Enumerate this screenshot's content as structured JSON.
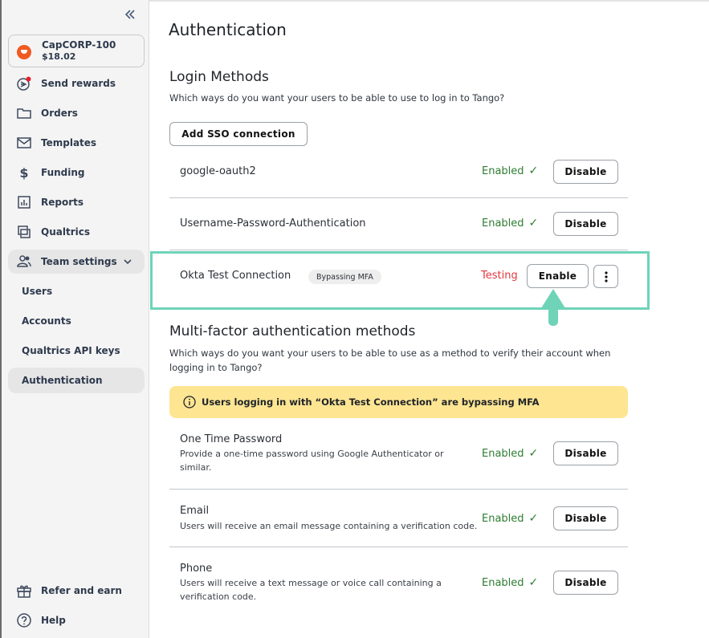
{
  "sidebar": {
    "collapse_icon": "double-chevron-left-icon",
    "account": {
      "name": "CapCORP-100",
      "balance": "$18.02",
      "logo_color": "#f05a22"
    },
    "items": [
      {
        "label": "Send rewards",
        "icon": "send-rewards-icon",
        "notification_dot": true
      },
      {
        "label": "Orders",
        "icon": "folder-icon"
      },
      {
        "label": "Templates",
        "icon": "mail-icon"
      },
      {
        "label": "Funding",
        "icon": "dollar-icon"
      },
      {
        "label": "Reports",
        "icon": "chart-icon"
      },
      {
        "label": "Qualtrics",
        "icon": "qualtrics-icon"
      },
      {
        "label": "Team settings",
        "icon": "team-icon",
        "expanded": true
      }
    ],
    "team_sub_items": [
      {
        "label": "Users"
      },
      {
        "label": "Accounts"
      },
      {
        "label": "Qualtrics API keys"
      },
      {
        "label": "Authentication",
        "active": true
      }
    ],
    "footer_items": [
      {
        "label": "Refer and earn",
        "icon": "gift-icon"
      },
      {
        "label": "Help",
        "icon": "help-icon"
      }
    ]
  },
  "main": {
    "title": "Authentication",
    "login_methods": {
      "title": "Login Methods",
      "description": "Which ways do you want your users to be able to use to log in to Tango?",
      "add_button": "Add SSO connection",
      "rows": [
        {
          "label": "google-oauth2",
          "status": "Enabled",
          "action": "Disable"
        },
        {
          "label": "Username-Password-Authentication",
          "status": "Enabled",
          "action": "Disable"
        },
        {
          "label": "Okta Test Connection",
          "badge": "Bypassing MFA",
          "status": "Testing",
          "action": "Enable",
          "has_menu": true,
          "highlighted": true
        }
      ]
    },
    "mfa_methods": {
      "title": "Multi-factor authentication methods",
      "description": "Which ways do you want your users to be able to use as a method to verify their account when logging in to Tango?",
      "alert": "Users logging in with “Okta Test Connection” are bypassing MFA",
      "rows": [
        {
          "label": "One Time Password",
          "sub": "Provide a one-time password using Google Authenticator or similar.",
          "status": "Enabled",
          "action": "Disable"
        },
        {
          "label": "Email",
          "sub": "Users will receive an email message containing a verification code.",
          "status": "Enabled",
          "action": "Disable"
        },
        {
          "label": "Phone",
          "sub": "Users will receive a text message or voice call containing a verification code.",
          "status": "Enabled",
          "action": "Disable"
        }
      ]
    },
    "status_check_glyph": "✓"
  },
  "colors": {
    "enabled": "#2e7d32",
    "testing": "#e0383e",
    "highlight": "#6fd3b8",
    "alert_bg": "#fde592"
  }
}
